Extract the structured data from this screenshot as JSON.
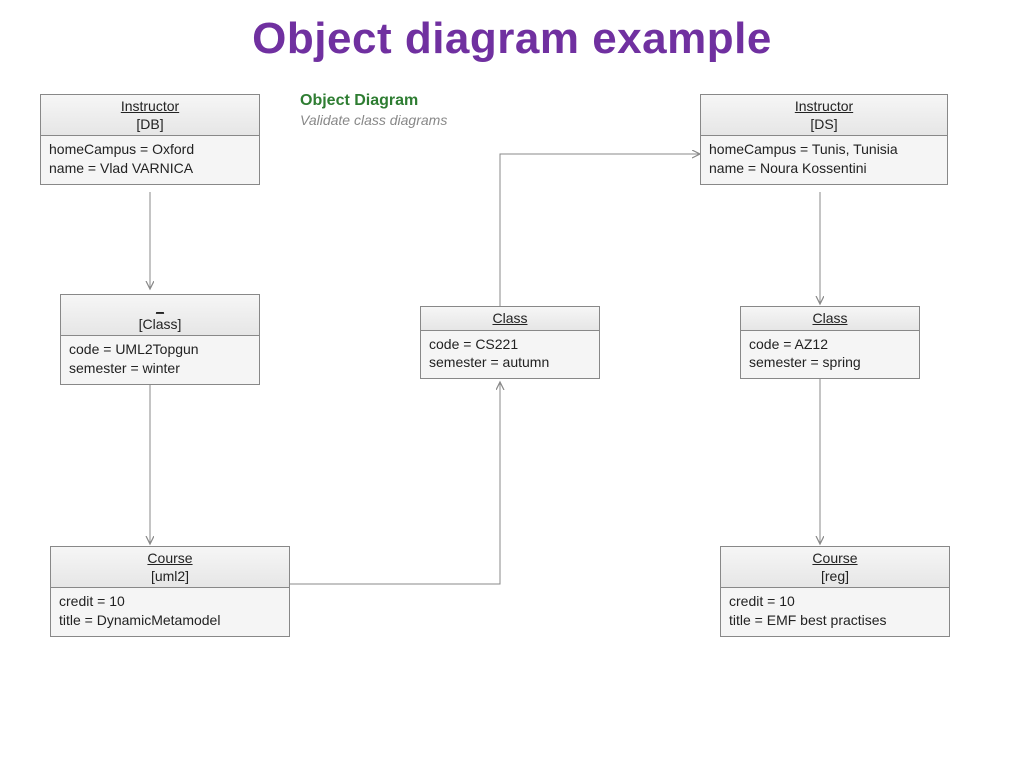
{
  "title": "Object diagram example",
  "subtitle": {
    "heading": "Object Diagram",
    "caption": "Validate class diagrams"
  },
  "objects": {
    "instrDB": {
      "type": "Instructor",
      "instance": "[DB]",
      "attrs": "homeCampus = Oxford\nname = Vlad VARNICA"
    },
    "instrDS": {
      "type": "Instructor",
      "instance": "[DS]",
      "attrs": "homeCampus = Tunis, Tunisia\nname = Noura Kossentini"
    },
    "classA": {
      "type": "_",
      "instance": "[Class]",
      "attrs": "code = UML2Topgun\nsemester = winter"
    },
    "classB": {
      "type": "Class",
      "instance": "",
      "attrs": "code = CS221\nsemester = autumn"
    },
    "classC": {
      "type": "Class",
      "instance": "",
      "attrs": "code = AZ12\nsemester = spring"
    },
    "courseUml2": {
      "type": "Course",
      "instance": "[uml2]",
      "attrs": "credit = 10\ntitle = DynamicMetamodel"
    },
    "courseReg": {
      "type": "Course",
      "instance": "[reg]",
      "attrs": "credit = 10\ntitle = EMF best practises"
    }
  }
}
